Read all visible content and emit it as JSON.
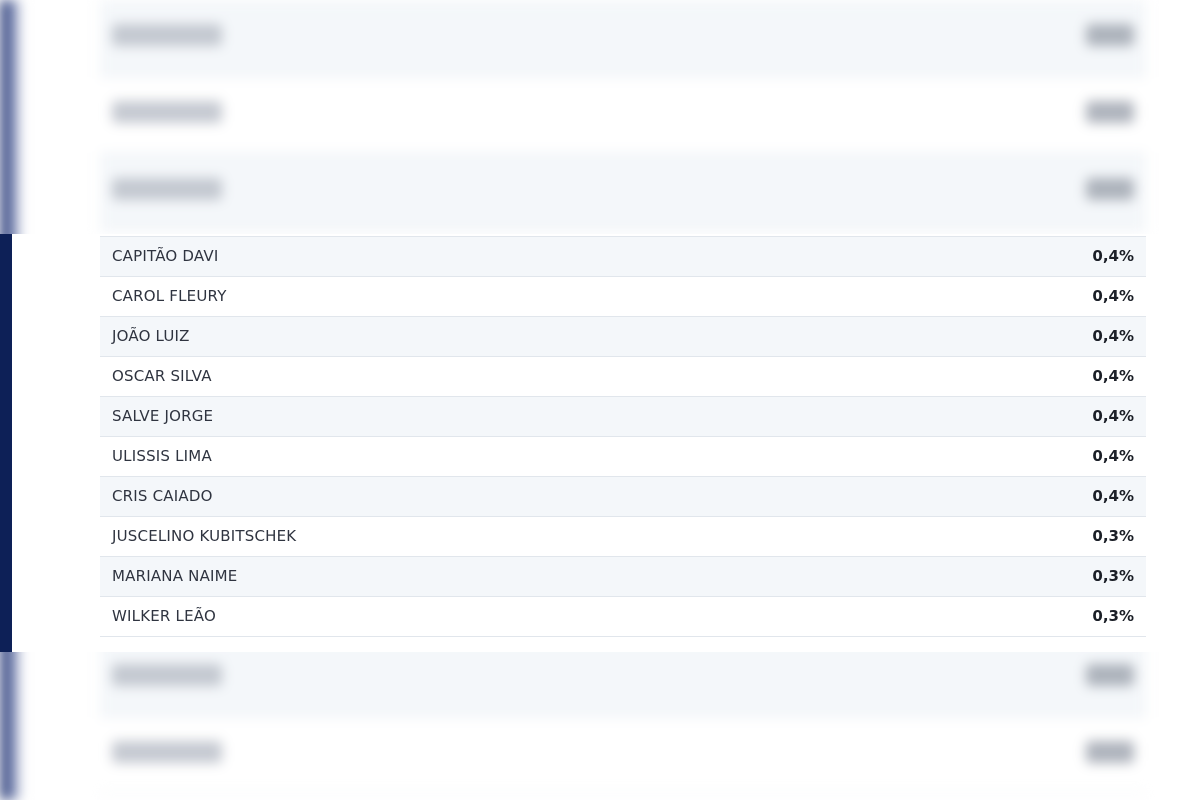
{
  "results": {
    "rows": [
      {
        "name": "CAPITÃO DAVI",
        "value": "0,4%"
      },
      {
        "name": "CAROL FLEURY",
        "value": "0,4%"
      },
      {
        "name": "JOÃO LUIZ",
        "value": "0,4%"
      },
      {
        "name": "OSCAR SILVA",
        "value": "0,4%"
      },
      {
        "name": "SALVE JORGE",
        "value": "0,4%"
      },
      {
        "name": "ULISSIS LIMA",
        "value": "0,4%"
      },
      {
        "name": "CRIS CAIADO",
        "value": "0,4%"
      },
      {
        "name": "JUSCELINO KUBITSCHEK",
        "value": "0,3%"
      },
      {
        "name": "MARIANA NAIME",
        "value": "0,3%"
      },
      {
        "name": "WILKER LEÃO",
        "value": "0,3%"
      }
    ]
  },
  "theme": {
    "accent": "#0d2057",
    "row_alt": "#f4f7fa",
    "row": "#ffffff"
  }
}
